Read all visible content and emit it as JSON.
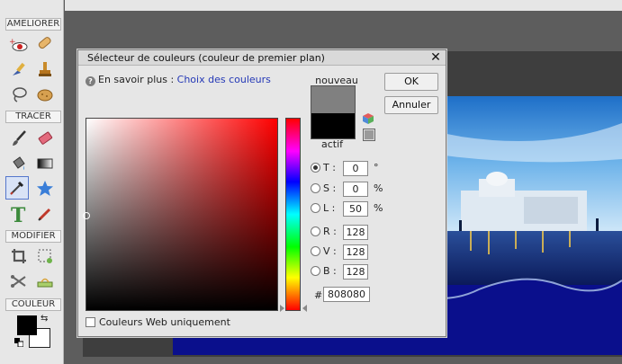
{
  "toolbox": {
    "sections": {
      "improve": "AMELIORER",
      "draw": "TRACER",
      "modify": "MODIFIER",
      "color": "COULEUR"
    },
    "tools": [
      "red-eye-icon",
      "spot-healing-icon",
      "smart-brush-icon",
      "clone-stamp-icon",
      "lasso-icon",
      "sponge-icon",
      "brush-icon",
      "eraser-icon",
      "paint-bucket-icon",
      "gradient-icon",
      "eyedropper-icon",
      "custom-shape-icon",
      "text-icon",
      "pencil-icon",
      "crop-icon",
      "recompose-icon",
      "content-aware-move-icon",
      "straighten-icon"
    ],
    "selected_tool": "eyedropper-icon",
    "foreground_color": "#000000",
    "background_color": "#ffffff"
  },
  "dialog": {
    "title": "Sélecteur de couleurs (couleur de premier plan)",
    "close": "✕",
    "help_prefix": "En savoir plus :",
    "help_link": "Choix des couleurs",
    "label_new": "nouveau",
    "label_current": "actif",
    "new_color": "#808080",
    "current_color": "#000000",
    "buttons": {
      "ok": "OK",
      "cancel": "Annuler"
    },
    "fields": {
      "hue": {
        "label": "T :",
        "value": "0",
        "unit": "°",
        "checked": true
      },
      "saturation": {
        "label": "S :",
        "value": "0",
        "unit": "%"
      },
      "lightness": {
        "label": "L :",
        "value": "50",
        "unit": "%"
      },
      "red": {
        "label": "R :",
        "value": "128"
      },
      "green": {
        "label": "V :",
        "value": "128"
      },
      "blue": {
        "label": "B :",
        "value": "128"
      }
    },
    "hex_label": "#",
    "hex_value": "808080",
    "web_only_label": "Couleurs Web uniquement",
    "field_hue_color": "#ff0000"
  }
}
